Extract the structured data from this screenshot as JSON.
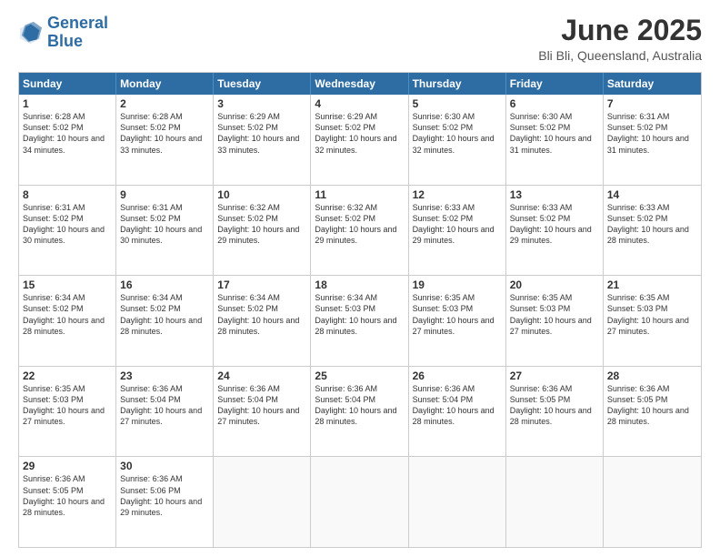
{
  "logo": {
    "line1": "General",
    "line2": "Blue"
  },
  "title": "June 2025",
  "location": "Bli Bli, Queensland, Australia",
  "days": [
    "Sunday",
    "Monday",
    "Tuesday",
    "Wednesday",
    "Thursday",
    "Friday",
    "Saturday"
  ],
  "rows": [
    [
      {
        "day": "",
        "empty": true
      },
      {
        "day": "1",
        "sunrise": "6:28 AM",
        "sunset": "5:02 PM",
        "daylight": "10 hours and 34 minutes."
      },
      {
        "day": "2",
        "sunrise": "6:28 AM",
        "sunset": "5:02 PM",
        "daylight": "10 hours and 33 minutes."
      },
      {
        "day": "3",
        "sunrise": "6:29 AM",
        "sunset": "5:02 PM",
        "daylight": "10 hours and 33 minutes."
      },
      {
        "day": "4",
        "sunrise": "6:29 AM",
        "sunset": "5:02 PM",
        "daylight": "10 hours and 32 minutes."
      },
      {
        "day": "5",
        "sunrise": "6:30 AM",
        "sunset": "5:02 PM",
        "daylight": "10 hours and 32 minutes."
      },
      {
        "day": "6",
        "sunrise": "6:30 AM",
        "sunset": "5:02 PM",
        "daylight": "10 hours and 31 minutes."
      },
      {
        "day": "7",
        "sunrise": "6:31 AM",
        "sunset": "5:02 PM",
        "daylight": "10 hours and 31 minutes."
      }
    ],
    [
      {
        "day": "8",
        "sunrise": "6:31 AM",
        "sunset": "5:02 PM",
        "daylight": "10 hours and 30 minutes."
      },
      {
        "day": "9",
        "sunrise": "6:31 AM",
        "sunset": "5:02 PM",
        "daylight": "10 hours and 30 minutes."
      },
      {
        "day": "10",
        "sunrise": "6:32 AM",
        "sunset": "5:02 PM",
        "daylight": "10 hours and 29 minutes."
      },
      {
        "day": "11",
        "sunrise": "6:32 AM",
        "sunset": "5:02 PM",
        "daylight": "10 hours and 29 minutes."
      },
      {
        "day": "12",
        "sunrise": "6:33 AM",
        "sunset": "5:02 PM",
        "daylight": "10 hours and 29 minutes."
      },
      {
        "day": "13",
        "sunrise": "6:33 AM",
        "sunset": "5:02 PM",
        "daylight": "10 hours and 29 minutes."
      },
      {
        "day": "14",
        "sunrise": "6:33 AM",
        "sunset": "5:02 PM",
        "daylight": "10 hours and 28 minutes."
      }
    ],
    [
      {
        "day": "15",
        "sunrise": "6:34 AM",
        "sunset": "5:02 PM",
        "daylight": "10 hours and 28 minutes."
      },
      {
        "day": "16",
        "sunrise": "6:34 AM",
        "sunset": "5:02 PM",
        "daylight": "10 hours and 28 minutes."
      },
      {
        "day": "17",
        "sunrise": "6:34 AM",
        "sunset": "5:02 PM",
        "daylight": "10 hours and 28 minutes."
      },
      {
        "day": "18",
        "sunrise": "6:34 AM",
        "sunset": "5:03 PM",
        "daylight": "10 hours and 28 minutes."
      },
      {
        "day": "19",
        "sunrise": "6:35 AM",
        "sunset": "5:03 PM",
        "daylight": "10 hours and 27 minutes."
      },
      {
        "day": "20",
        "sunrise": "6:35 AM",
        "sunset": "5:03 PM",
        "daylight": "10 hours and 27 minutes."
      },
      {
        "day": "21",
        "sunrise": "6:35 AM",
        "sunset": "5:03 PM",
        "daylight": "10 hours and 27 minutes."
      }
    ],
    [
      {
        "day": "22",
        "sunrise": "6:35 AM",
        "sunset": "5:03 PM",
        "daylight": "10 hours and 27 minutes."
      },
      {
        "day": "23",
        "sunrise": "6:36 AM",
        "sunset": "5:04 PM",
        "daylight": "10 hours and 27 minutes."
      },
      {
        "day": "24",
        "sunrise": "6:36 AM",
        "sunset": "5:04 PM",
        "daylight": "10 hours and 27 minutes."
      },
      {
        "day": "25",
        "sunrise": "6:36 AM",
        "sunset": "5:04 PM",
        "daylight": "10 hours and 28 minutes."
      },
      {
        "day": "26",
        "sunrise": "6:36 AM",
        "sunset": "5:04 PM",
        "daylight": "10 hours and 28 minutes."
      },
      {
        "day": "27",
        "sunrise": "6:36 AM",
        "sunset": "5:05 PM",
        "daylight": "10 hours and 28 minutes."
      },
      {
        "day": "28",
        "sunrise": "6:36 AM",
        "sunset": "5:05 PM",
        "daylight": "10 hours and 28 minutes."
      }
    ],
    [
      {
        "day": "29",
        "sunrise": "6:36 AM",
        "sunset": "5:05 PM",
        "daylight": "10 hours and 28 minutes."
      },
      {
        "day": "30",
        "sunrise": "6:36 AM",
        "sunset": "5:06 PM",
        "daylight": "10 hours and 29 minutes."
      },
      {
        "day": "",
        "empty": true
      },
      {
        "day": "",
        "empty": true
      },
      {
        "day": "",
        "empty": true
      },
      {
        "day": "",
        "empty": true
      },
      {
        "day": "",
        "empty": true
      }
    ]
  ]
}
